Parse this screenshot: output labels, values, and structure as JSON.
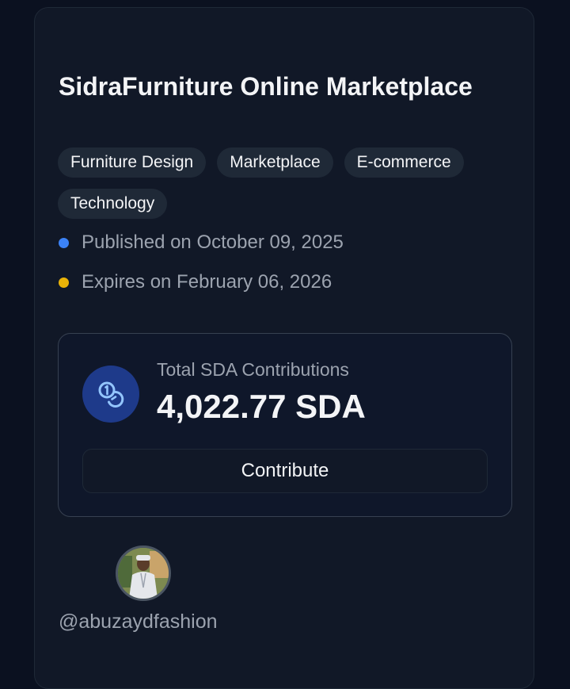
{
  "project": {
    "title": "SidraFurniture Online Marketplace",
    "tags": [
      "Furniture Design",
      "Marketplace",
      "E-commerce",
      "Technology"
    ],
    "published": "Published on October 09, 2025",
    "expires": "Expires on February 06, 2026"
  },
  "contributions": {
    "label": "Total SDA Contributions",
    "value": "4,022.77 SDA",
    "button_label": "Contribute",
    "icon": "coins-icon"
  },
  "creator": {
    "username": "@abuzaydfashion",
    "avatar": "user-avatar"
  },
  "colors": {
    "background": "#0b1120",
    "card": "#111827",
    "published_dot": "#3b82f6",
    "expires_dot": "#eab308",
    "icon_circle": "#1e3a8a"
  }
}
